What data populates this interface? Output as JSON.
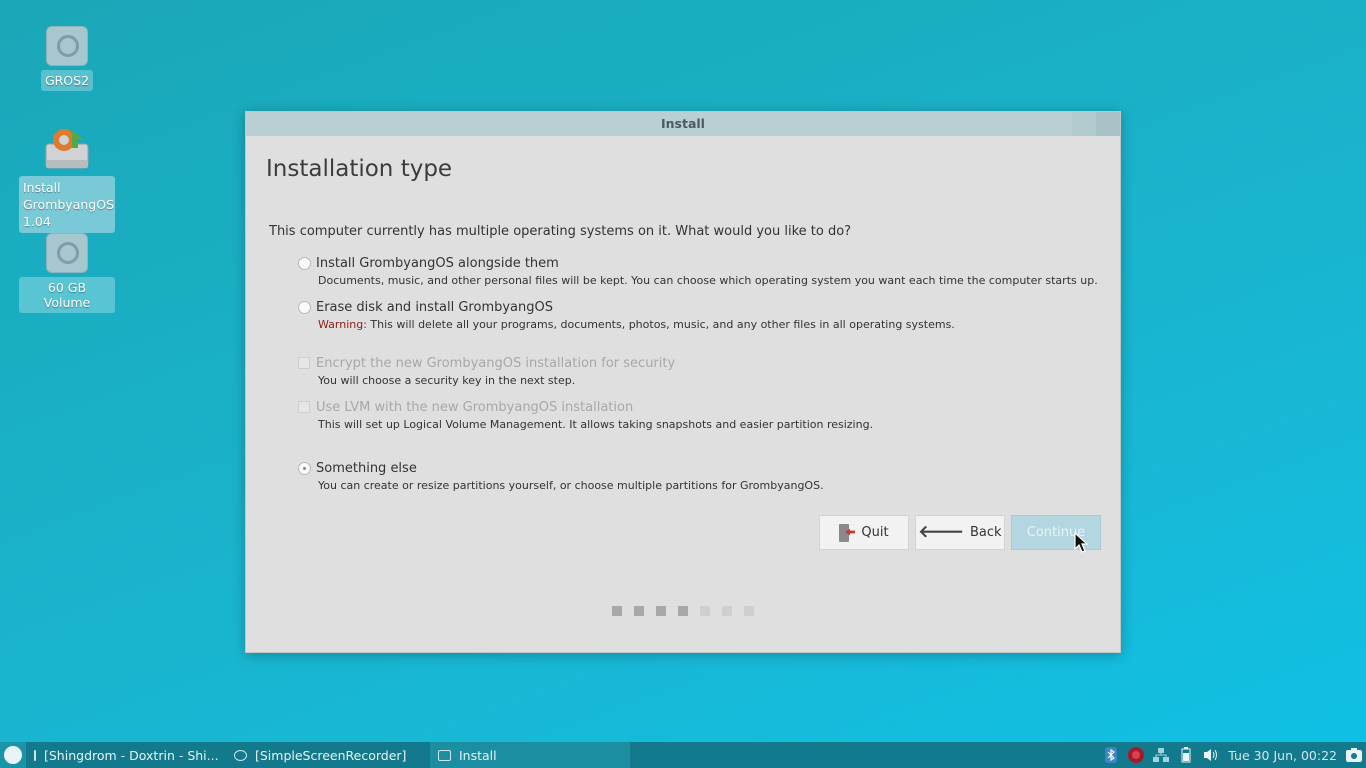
{
  "desktop": {
    "icons": [
      {
        "label": "GROS2"
      },
      {
        "label": "Install GrombyangOS 1.04"
      },
      {
        "label": "60 GB Volume"
      }
    ]
  },
  "window": {
    "title": "Install",
    "page_title": "Installation type",
    "question": "This computer currently has multiple operating systems on it. What would you like to do?",
    "options": [
      {
        "label": "Install GrombyangOS alongside them",
        "desc": "Documents, music, and other personal files will be kept. You can choose which operating system you want each time the computer starts up."
      },
      {
        "label": "Erase disk and install GrombyangOS",
        "warn": "Warning:",
        "desc": " This will delete all your programs, documents, photos, music, and any other files in all operating systems."
      },
      {
        "label": "Encrypt the new GrombyangOS installation for security",
        "desc": "You will choose a security key in the next step."
      },
      {
        "label": "Use LVM with the new GrombyangOS installation",
        "desc": "This will set up Logical Volume Management. It allows taking snapshots and easier partition resizing."
      },
      {
        "label": "Something else",
        "desc": "You can create or resize partitions yourself, or choose multiple partitions for GrombyangOS."
      }
    ],
    "buttons": {
      "quit": "Quit",
      "back": "Back",
      "continue": "Continue"
    },
    "progress": {
      "total": 7,
      "completed": 4
    }
  },
  "taskbar": {
    "tasks": [
      {
        "label": "[Shingdrom - Doxtrin - Shi..."
      },
      {
        "label": "[SimpleScreenRecorder]"
      },
      {
        "label": "Install"
      }
    ],
    "clock": "Tue 30 Jun, 00:22"
  },
  "colors": {
    "accent": "#1aa7b8",
    "warning": "#8c1d18",
    "continue_bg": "#b3d6e0"
  }
}
